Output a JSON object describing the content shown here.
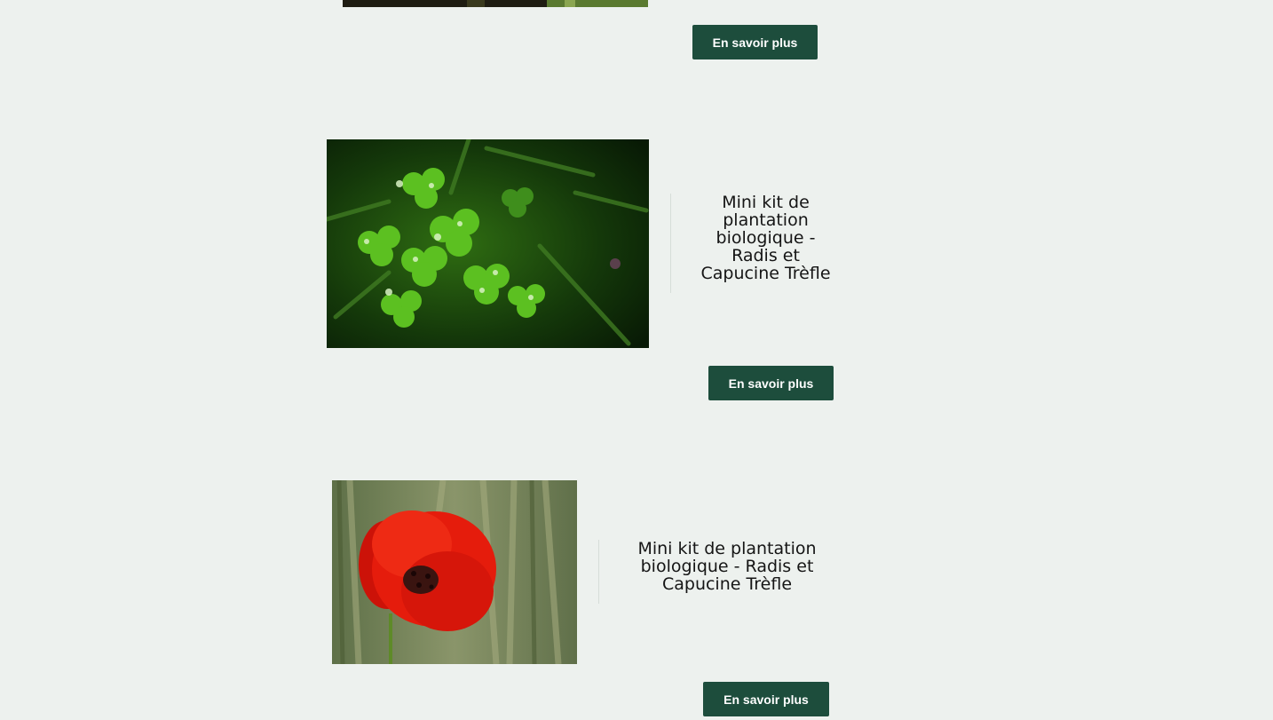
{
  "products": [
    {
      "image_alt": "partial product photo (cropped)",
      "button_label": "En savoir plus"
    },
    {
      "image_alt": "clover leaves with water droplets",
      "title": "Mini kit de plantation biologique - Radis et Capucine Trèfle",
      "button_label": "En savoir plus"
    },
    {
      "image_alt": "red poppy flower",
      "title": "Mini kit de plantation biologique - Radis et Capucine Trèfle",
      "button_label": "En savoir plus"
    }
  ],
  "colors": {
    "background": "#edf1ee",
    "button": "#1d4d3c",
    "button_text": "#ffffff",
    "title_text": "#151515"
  }
}
